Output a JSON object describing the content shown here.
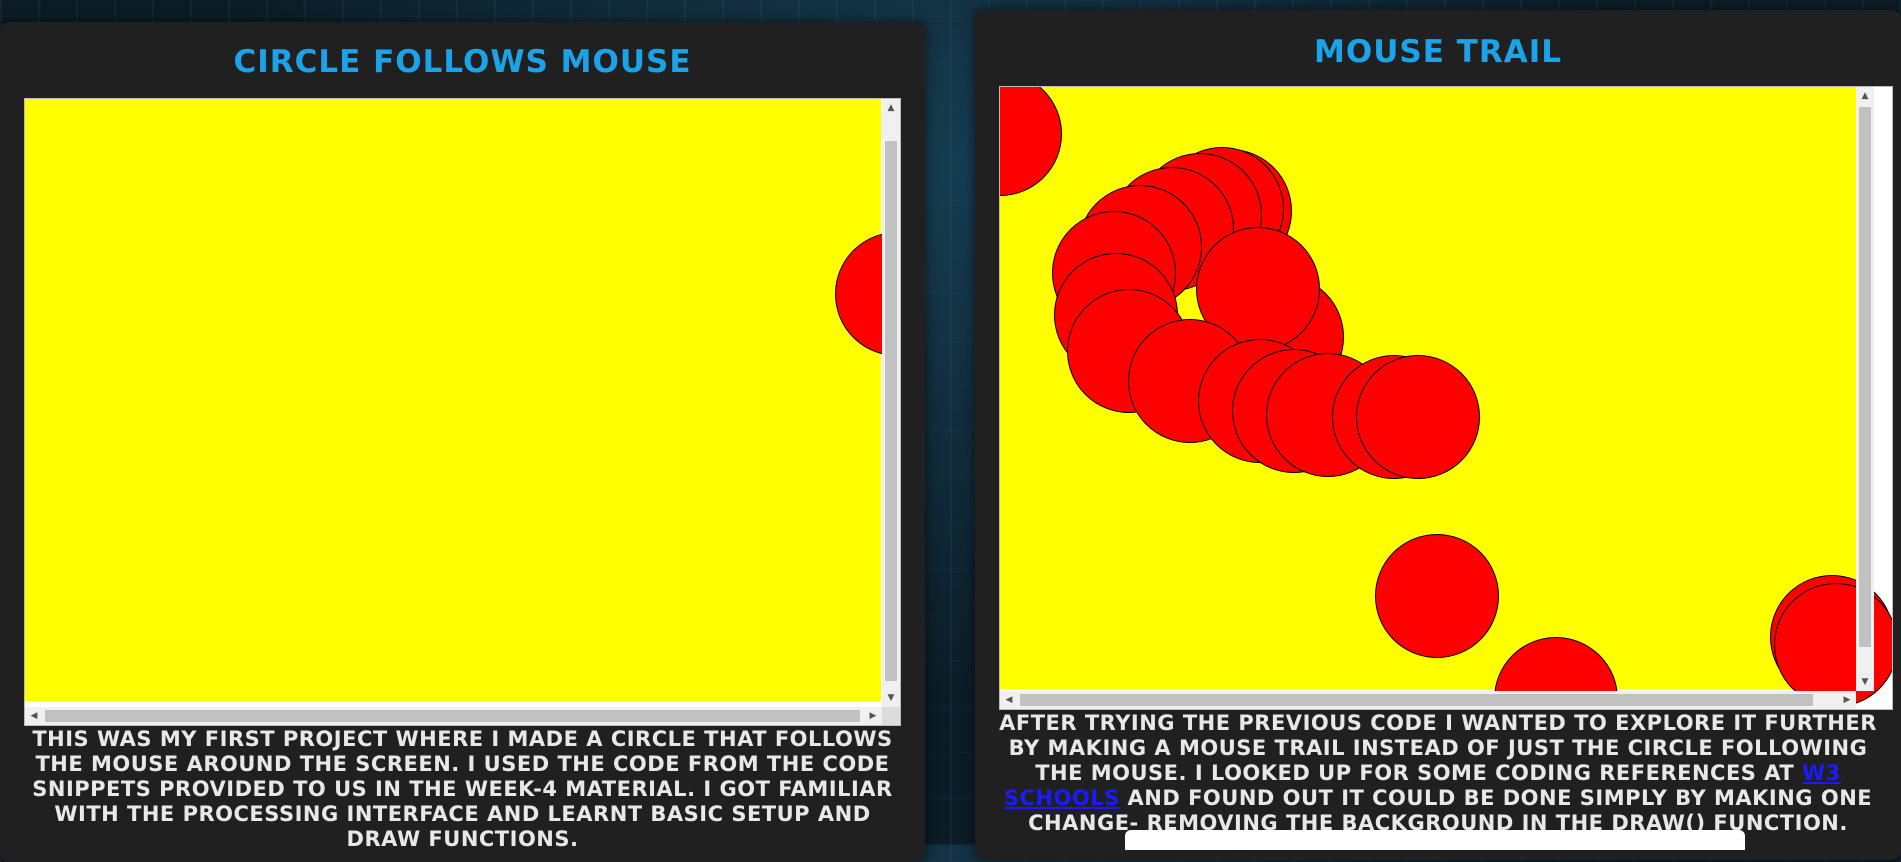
{
  "left_panel": {
    "title": "CIRCLE FOLLOWS MOUSE",
    "canvas_color": "#ffff00",
    "circle_color": "#ff0000",
    "description": "THIS WAS MY FIRST PROJECT WHERE I MADE A CIRCLE THAT FOLLOWS THE MOUSE AROUND THE SCREEN. I USED THE CODE FROM THE CODE SNIPPETS PROVIDED TO US IN THE WEEK-4 MATERIAL. I GOT FAMILIAR WITH THE PROCESSING INTERFACE AND LEARNT BASIC SETUP AND DRAW FUNCTIONS."
  },
  "right_panel": {
    "title": "MOUSE TRAIL",
    "canvas_color": "#ffff00",
    "circle_color": "#ff0000",
    "description_before_link": "AFTER TRYING THE PREVIOUS CODE I WANTED TO EXPLORE IT FURTHER BY MAKING A MOUSE TRAIL INSTEAD OF JUST THE CIRCLE FOLLOWING THE MOUSE. I LOOKED UP FOR SOME CODING REFERENCES AT",
    "link_text": "W3 SCHOOLS",
    "description_after_link": "AND FOUND OUT IT COULD BE DONE SIMPLY BY MAKING ONE CHANGE- REMOVING THE BACKGROUND IN THE DRAW() FUNCTION."
  },
  "colors": {
    "title_accent": "#1aa3e8",
    "panel_bg": "#202020",
    "link": "#1a1aff"
  },
  "icons": [
    "scroll-up-arrow-icon",
    "scroll-down-arrow-icon",
    "scroll-left-arrow-icon",
    "scroll-right-arrow-icon"
  ]
}
